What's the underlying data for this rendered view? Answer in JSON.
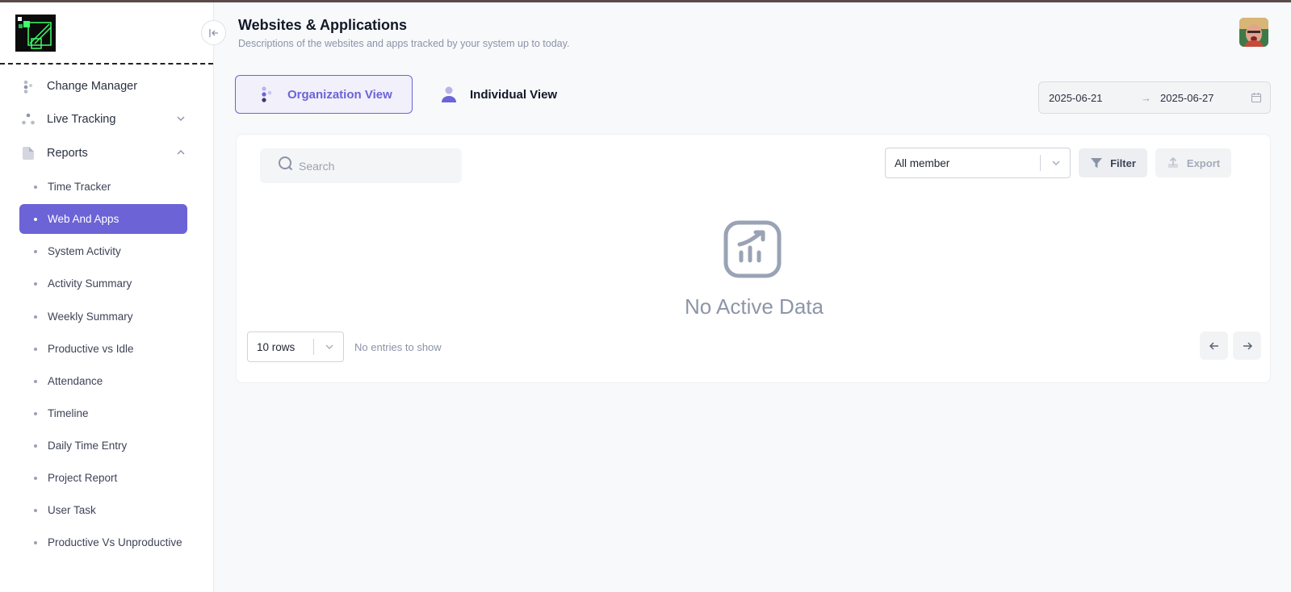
{
  "sidebar": {
    "items": [
      {
        "label": "Change Manager",
        "icon": "change-manager-icon"
      },
      {
        "label": "Live Tracking",
        "icon": "live-tracking-icon",
        "expanded": false
      },
      {
        "label": "Reports",
        "icon": "reports-icon",
        "expanded": true
      }
    ],
    "report_items": [
      {
        "label": "Time Tracker"
      },
      {
        "label": "Web And Apps",
        "active": true
      },
      {
        "label": "System Activity"
      },
      {
        "label": "Activity Summary"
      },
      {
        "label": "Weekly Summary"
      },
      {
        "label": "Productive vs Idle"
      },
      {
        "label": "Attendance"
      },
      {
        "label": "Timeline"
      },
      {
        "label": "Daily Time Entry"
      },
      {
        "label": "Project Report"
      },
      {
        "label": "User Task"
      },
      {
        "label": "Productive Vs Unproductive"
      }
    ]
  },
  "header": {
    "title": "Websites & Applications",
    "subtitle": "Descriptions of the websites and apps tracked by your system up to today."
  },
  "views": {
    "organization": "Organization View",
    "individual": "Individual View",
    "selected": "organization"
  },
  "date_range": {
    "start": "2025-06-21",
    "separator": "→",
    "end": "2025-06-27"
  },
  "toolbar": {
    "search_placeholder": "Search",
    "member_select": "All member",
    "filter_label": "Filter",
    "export_label": "Export"
  },
  "empty_state": {
    "message": "No Active Data"
  },
  "pagination": {
    "rows_per_page": "10 rows",
    "entries_text": "No entries to show"
  },
  "colors": {
    "accent": "#6c63d6",
    "muted": "#8d96a8"
  }
}
